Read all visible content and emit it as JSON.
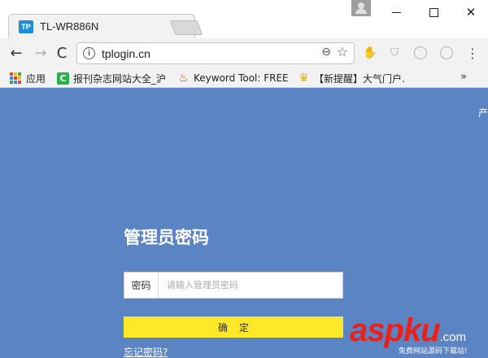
{
  "tab": {
    "favicon": "TP",
    "title": "TL-WR886N",
    "close": "×"
  },
  "toolbar": {
    "back": "←",
    "forward": "→",
    "reload": "C",
    "url": "tplogin.cn",
    "info": "i",
    "menu": "⋮"
  },
  "bookmarks": {
    "apps_label": "应用",
    "items": [
      {
        "icon": "C",
        "label": "报刊杂志网站大全_沪"
      },
      {
        "icon": "flame-icon",
        "label": "Keyword Tool: FREE"
      },
      {
        "icon": "trophy-icon",
        "label": "【新提醒】大气门户."
      }
    ],
    "more": "»"
  },
  "page": {
    "corner_text": "产",
    "title": "管理员密码",
    "password_label": "密码",
    "password_placeholder": "请输入管理员密码",
    "password_value": "",
    "confirm_label": "确定",
    "forgot_link": "忘记密码?"
  },
  "watermark": {
    "asp": "asp",
    "ku": "ku",
    "com": ".com",
    "sub": "免费网站源码下载站!"
  },
  "colors": {
    "page_bg": "#5b84c4",
    "confirm_bg": "#fde92a",
    "watermark_red": "#e8211b",
    "favicon_blue": "#1a8fd8"
  }
}
